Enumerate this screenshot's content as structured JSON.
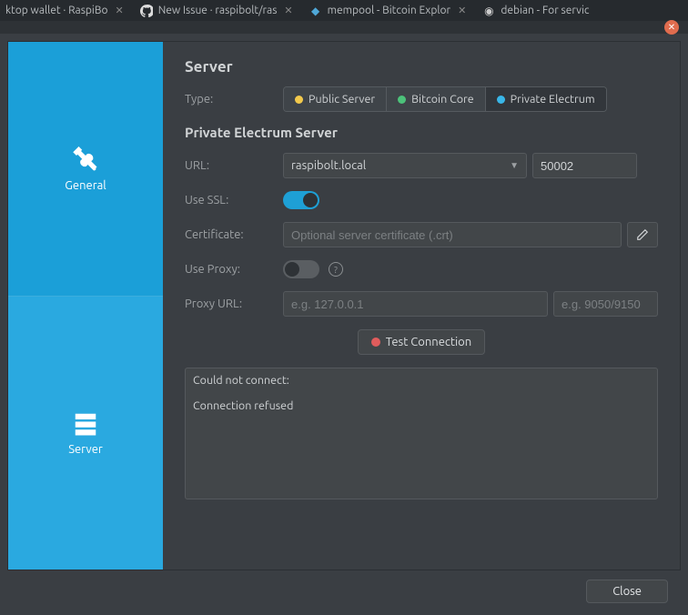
{
  "browser_tabs": [
    {
      "label": "ktop wallet · RaspiBo",
      "icon": ""
    },
    {
      "label": "New Issue · raspibolt/ras",
      "icon": "github"
    },
    {
      "label": "mempool - Bitcoin Explor",
      "icon": "cube"
    },
    {
      "label": "debian - For servic",
      "icon": "swirl"
    }
  ],
  "sidebar": {
    "general": "General",
    "server": "Server"
  },
  "section_title": "Server",
  "type_label": "Type:",
  "types": {
    "public": "Public Server",
    "core": "Bitcoin Core",
    "private": "Private Electrum"
  },
  "subsection_title": "Private Electrum Server",
  "url_label": "URL:",
  "url_value": "raspibolt.local",
  "port_value": "50002",
  "ssl_label": "Use SSL:",
  "cert_label": "Certificate:",
  "cert_placeholder": "Optional server certificate (.crt)",
  "proxy_label": "Use Proxy:",
  "proxy_url_label": "Proxy URL:",
  "proxy_host_placeholder": "e.g. 127.0.0.1",
  "proxy_port_placeholder": "e.g. 9050/9150",
  "test_button": "Test Connection",
  "log_text": "Could not connect:\n\nConnection refused",
  "close_button": "Close"
}
